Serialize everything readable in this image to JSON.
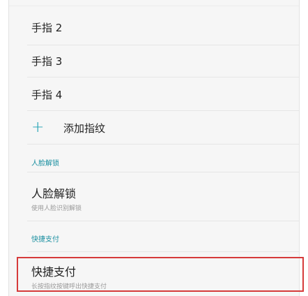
{
  "fingerprints": [
    {
      "label": "手指 2"
    },
    {
      "label": "手指 3"
    },
    {
      "label": "手指 4"
    }
  ],
  "add_fingerprint": {
    "icon": "plus-icon",
    "label": "添加指纹"
  },
  "face_unlock_section": {
    "header": "人脸解锁",
    "title": "人脸解锁",
    "subtitle": "使用人脸识别解锁"
  },
  "quick_pay_section": {
    "header": "快捷支付",
    "title": "快捷支付",
    "subtitle": "长按指纹按键呼出快捷支付"
  },
  "colors": {
    "accent": "#1aa0b2",
    "highlight": "#d63a3a"
  }
}
